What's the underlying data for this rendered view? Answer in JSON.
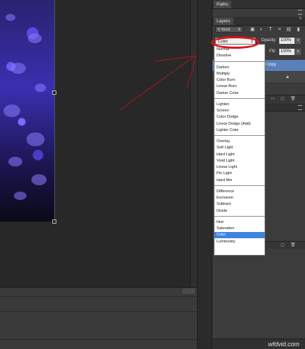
{
  "panels": {
    "paths_tab": "Paths",
    "layers_tab": "Layers"
  },
  "layers": {
    "kind_filter": "Kind",
    "blend_mode": "Color",
    "opacity_label": "Opacity:",
    "opacity_value": "100%",
    "fill_label": "Fill:",
    "fill_value": "100%",
    "selected_layer_label": "l copy"
  },
  "blend_menu": {
    "groups": [
      [
        "Normal",
        "Dissolve"
      ],
      [
        "Darken",
        "Multiply",
        "Color Burn",
        "Linear Burn",
        "Darker Color"
      ],
      [
        "Lighten",
        "Screen",
        "Color Dodge",
        "Linear Dodge (Add)",
        "Lighter Color"
      ],
      [
        "Overlay",
        "Soft Light",
        "Hard Light",
        "Vivid Light",
        "Linear Light",
        "Pin Light",
        "Hard Mix"
      ],
      [
        "Difference",
        "Exclusion",
        "Subtract",
        "Divide"
      ],
      [
        "Hue",
        "Saturation",
        "Color",
        "Luminosity"
      ]
    ],
    "selected": "Color"
  },
  "watermark": "wfdvid.com",
  "colors": {
    "selection_blue": "#3d83e0",
    "annotation_red": "#e0101a",
    "photo_purple": "#5a4be0",
    "layer_highlight": "#5b7fb8"
  },
  "icons": [
    "kind-search-icon",
    "pixel-filter-icon",
    "adjustment-filter-icon",
    "type-filter-icon",
    "shape-filter-icon",
    "smart-object-filter-icon",
    "filter-toggle-icon",
    "lock-icon",
    "panel-menu-icon",
    "close-icon",
    "trash-icon"
  ]
}
